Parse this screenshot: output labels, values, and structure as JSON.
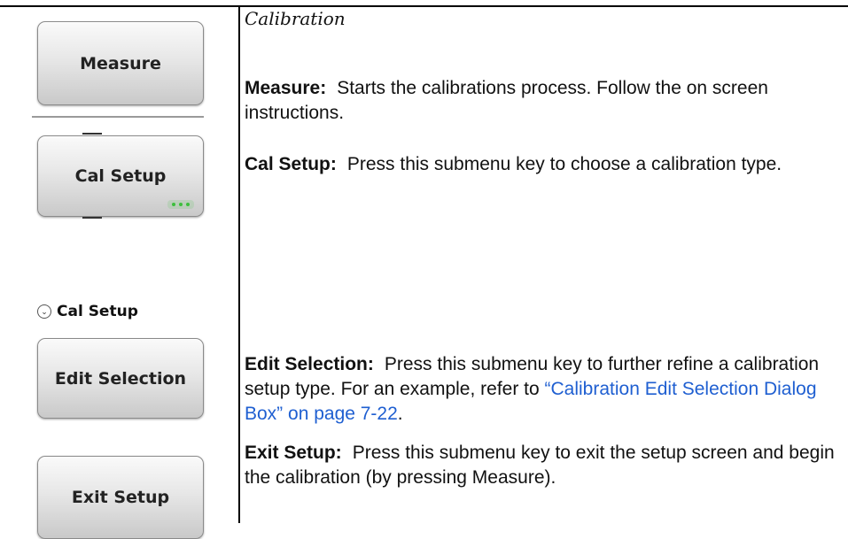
{
  "section_title": "Calibration",
  "keys": {
    "measure": "Measure",
    "cal_setup": "Cal Setup",
    "edit_selection": "Edit Selection",
    "exit_setup": "Exit Setup"
  },
  "submenu_header": "Cal Setup",
  "descriptions": {
    "measure": {
      "term": "Measure:",
      "text": "Starts the calibrations process. Follow the on screen instructions."
    },
    "cal_setup": {
      "term": "Cal Setup:",
      "text": "Press this submenu key to choose a calibration type."
    },
    "edit_selection": {
      "term": "Edit Selection:",
      "text": "Press this submenu key to further refine a calibration setup type. For an example, refer to",
      "link": "“Calibration Edit Selection Dialog Box” on page 7-22",
      "suffix": "."
    },
    "exit_setup": {
      "term": "Exit Setup:",
      "text": "Press this submenu key to exit the setup screen and begin the calibration (by pressing Measure)."
    }
  },
  "colors": {
    "link": "#1f5fd1",
    "indicator": "#3cbf3c"
  },
  "icons": {
    "submenu": "chevron-down-circle-icon",
    "more": "more-dots-icon"
  }
}
